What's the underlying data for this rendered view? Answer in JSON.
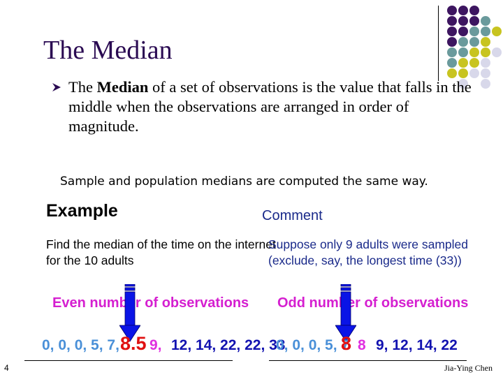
{
  "slide": {
    "title": "The Median",
    "definition": {
      "prefix": "The ",
      "bold": "Median",
      "suffix": " of a set of observations is the value that falls in the middle when the observations are arranged in order of magnitude."
    },
    "note": "Sample and population medians are computed the same way.",
    "example_heading": "Example",
    "comment_heading": "Comment",
    "example_text_line1": "Find the median of the time on the internet",
    "example_text_line2": "for the 10 adults",
    "comment_text_line1": "Suppose only 9 adults were sampled",
    "comment_text_line2": "(exclude, say,  the longest time (33))",
    "even_label": "Even number of observations",
    "odd_label": "Odd number of observations",
    "even_sequence": {
      "before": "0, 0, 0, 5, 7,",
      "mid_overlay": "8,",
      "median": "8.5",
      "next": "9,",
      "after": "12, 14, 22, 22, 33"
    },
    "odd_sequence": {
      "before": "0, 0, 0, 5, 7",
      "median": "8",
      "next": "8",
      "after": "9, 12, 14, 22"
    },
    "page_number": "4",
    "author": "Jia-Ying Chen",
    "colors": {
      "title": "#2a0a52",
      "accent_magenta": "#d51fd0",
      "comment_blue": "#1a2a8a",
      "arrow_blue": "#0a14e6",
      "median_red": "#e01010"
    }
  }
}
